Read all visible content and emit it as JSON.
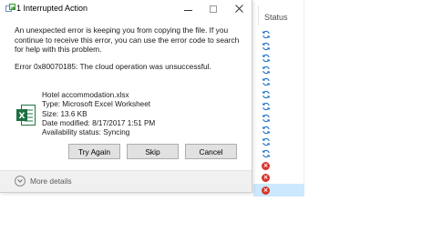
{
  "dialog": {
    "title": "1 Interrupted Action",
    "message": "An unexpected error is keeping you from copying the file. If you continue to receive this error, you can use the error code to search for help with this problem.",
    "error_code": "Error 0x80070185: The cloud operation was unsuccessful.",
    "file": {
      "name": "Hotel accommodation.xlsx",
      "type": "Type: Microsoft Excel Worksheet",
      "size": "Size: 13.6 KB",
      "date_modified": "Date modified: 8/17/2017 1:51 PM",
      "availability": "Availability status: Syncing",
      "icon": "excel-file-icon"
    },
    "buttons": {
      "try_again": "Try Again",
      "skip": "Skip",
      "cancel": "Cancel"
    },
    "more_details": "More details",
    "window_controls": [
      "minimize",
      "maximize",
      "close"
    ]
  },
  "background_pane": {
    "column_header": "Status",
    "rows": [
      "sync",
      "sync",
      "sync",
      "sync",
      "sync",
      "sync",
      "sync",
      "sync",
      "sync",
      "sync",
      "sync",
      "error",
      "error",
      "error"
    ],
    "colors": {
      "sync": "#1e73c8",
      "error": "#d9342b",
      "selected": "#cce8ff"
    }
  }
}
